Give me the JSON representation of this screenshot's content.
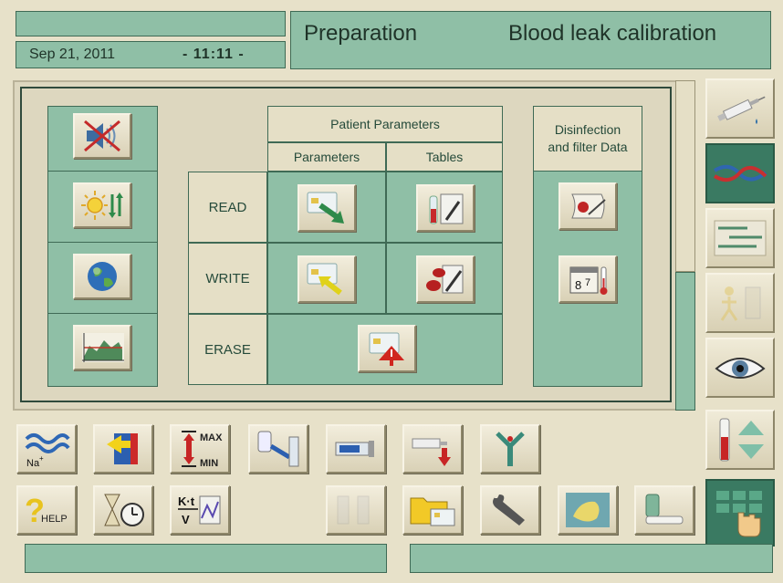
{
  "header": {
    "date": "Sep 21, 2011",
    "time": "- 11:11 -",
    "mode": "Preparation",
    "screen_title": "Blood leak calibration"
  },
  "table": {
    "patient_params_header": "Patient Parameters",
    "parameters_header": "Parameters",
    "tables_header": "Tables",
    "disinfection_header": "Disinfection and filter Data",
    "row_read": "READ",
    "row_write": "WRITE",
    "row_erase": "ERASE"
  },
  "icons": {
    "left_column": [
      "sound-off-icon",
      "brightness-icon",
      "globe-icon",
      "graph-icon"
    ],
    "side": [
      "syringe-icon",
      "crossed-lines-icon",
      "list-icon",
      "patient-connect-icon",
      "eye-icon",
      "level-arrows-icon",
      "keypad-touch-icon"
    ],
    "bottom_row1": [
      "sodium-wave-icon",
      "swap-arrows-icon",
      "max-min-icon",
      "bag-clamp-icon",
      "pump-icon",
      "syringe-down-icon",
      "y-connector-icon"
    ],
    "bottom_row2": [
      "help-icon",
      "timer-icon",
      "ktv-icon",
      "disabled-tubes-icon",
      "folder-card-icon",
      "wrench-icon",
      "cleaning-icon",
      "cartridge-icon"
    ]
  },
  "bottom_row2_labels": {
    "help": "HELP",
    "ktv_top": "K·t",
    "ktv_bottom": "V"
  },
  "bottom_row1_labels": {
    "na": "Na",
    "max": "MAX",
    "min": "MIN"
  },
  "colors": {
    "background": "#e7e1c9",
    "panel_green": "#8fbfa6",
    "panel_border": "#3f6a55",
    "text_dark": "#254a3a",
    "active_green": "#3a7a62"
  }
}
